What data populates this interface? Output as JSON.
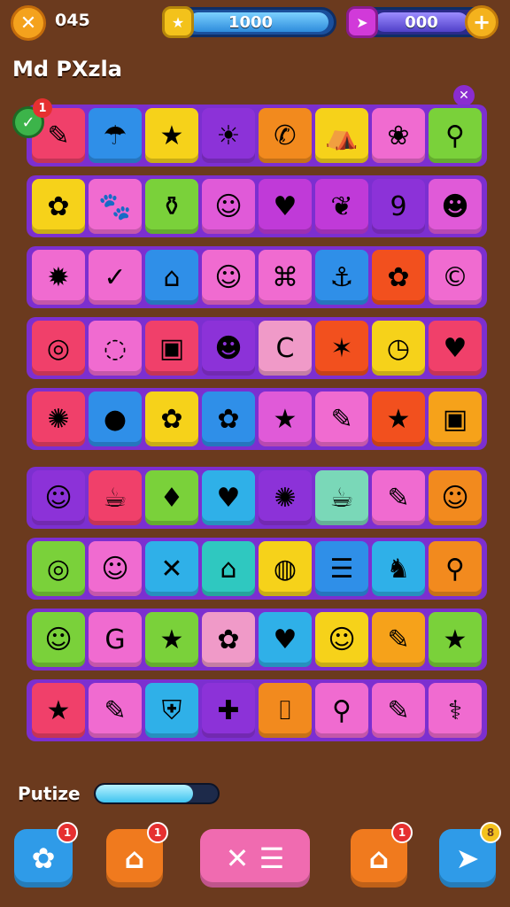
{
  "header": {
    "coin_icon_glyph": "✕",
    "coin_count": "045",
    "left_bar_value": "1000",
    "left_bar_badge_glyph": "★",
    "right_bar_value": "000",
    "right_bar_badge_glyph": "➤",
    "plus_glyph": "+"
  },
  "title": "Md PXzla",
  "progress": {
    "label": "Putize",
    "fraction": 0.8
  },
  "board_a": {
    "rows": [
      [
        [
          "#f0406a",
          "✎"
        ],
        [
          "#2f8fe8",
          "☂"
        ],
        [
          "#f6d21a",
          "★"
        ],
        [
          "#8c32d8",
          "☀"
        ],
        [
          "#f28a1e",
          "✆"
        ],
        [
          "#f6d21a",
          "⛺"
        ],
        [
          "#f06bd0",
          "❀"
        ],
        [
          "#7ad13a",
          "⚲"
        ]
      ],
      [
        [
          "#f6d21a",
          "✿"
        ],
        [
          "#f06bd0",
          "🐾"
        ],
        [
          "#7ad13a",
          "⚱"
        ],
        [
          "#e05ad8",
          "☺"
        ],
        [
          "#c03ad8",
          "♥"
        ],
        [
          "#c03ad8",
          "❦"
        ],
        [
          "#8c32d8",
          "9"
        ],
        [
          "#e05ad8",
          "☻"
        ]
      ],
      [
        [
          "#f06bd0",
          "✹"
        ],
        [
          "#f06bd0",
          "✓"
        ],
        [
          "#2f8fe8",
          "⌂"
        ],
        [
          "#f06bd0",
          "☺"
        ],
        [
          "#f06bd0",
          "⌘"
        ],
        [
          "#2f8fe8",
          "⚓"
        ],
        [
          "#f2501e",
          "✿"
        ],
        [
          "#f06bd0",
          "©"
        ]
      ],
      [
        [
          "#f0406a",
          "◎"
        ],
        [
          "#f06bd0",
          "◌"
        ],
        [
          "#f0406a",
          "▣"
        ],
        [
          "#8c32d8",
          "☻"
        ],
        [
          "#f09ac8",
          "C"
        ],
        [
          "#f2501e",
          "✶"
        ],
        [
          "#f6d21a",
          "◷"
        ],
        [
          "#f0406a",
          "♥"
        ]
      ],
      [
        [
          "#f0406a",
          "✺"
        ],
        [
          "#2f8fe8",
          "●"
        ],
        [
          "#f6d21a",
          "✿"
        ],
        [
          "#2f8fe8",
          "✿"
        ],
        [
          "#e05ad8",
          "★"
        ],
        [
          "#f06bd0",
          "✎"
        ],
        [
          "#f2501e",
          "★"
        ],
        [
          "#f6a21a",
          "▣"
        ]
      ]
    ]
  },
  "board_b": {
    "rows": [
      [
        [
          "#8c32d8",
          "☺"
        ],
        [
          "#f0406a",
          "☕"
        ],
        [
          "#7ad13a",
          "♦"
        ],
        [
          "#2fb0e8",
          "♥"
        ],
        [
          "#8c32d8",
          "✺"
        ],
        [
          "#7ad8b8",
          "☕"
        ],
        [
          "#f06bd0",
          "✎"
        ],
        [
          "#f28a1e",
          "☺"
        ]
      ],
      [
        [
          "#7ad13a",
          "◎"
        ],
        [
          "#f06bd0",
          "☺"
        ],
        [
          "#2fb0e8",
          "✕"
        ],
        [
          "#2fc8c0",
          "⌂"
        ],
        [
          "#f6d21a",
          "◍"
        ],
        [
          "#2f8fe8",
          "☰"
        ],
        [
          "#2fb0e8",
          "♞"
        ],
        [
          "#f28a1e",
          "⚲"
        ]
      ],
      [
        [
          "#7ad13a",
          "☺"
        ],
        [
          "#f06bd0",
          "G"
        ],
        [
          "#7ad13a",
          "★"
        ],
        [
          "#f09ac8",
          "✿"
        ],
        [
          "#2fb0e8",
          "♥"
        ],
        [
          "#f6d21a",
          "☺"
        ],
        [
          "#f6a21a",
          "✎"
        ],
        [
          "#7ad13a",
          "★"
        ]
      ],
      [
        [
          "#f0406a",
          "★"
        ],
        [
          "#f06bd0",
          "✎"
        ],
        [
          "#2fb0e8",
          "⛨"
        ],
        [
          "#8c32d8",
          "✚"
        ],
        [
          "#f28a1e",
          "⌷"
        ],
        [
          "#f06bd0",
          "⚲"
        ],
        [
          "#f06bd0",
          "✎"
        ],
        [
          "#f06bd0",
          "⚕"
        ]
      ]
    ]
  },
  "corner_close_glyph": "✕",
  "check_badge": {
    "glyph": "✓",
    "count": "1"
  },
  "bottom_buttons": [
    {
      "glyph": "✿",
      "badge": "1"
    },
    {
      "glyph": "⌂",
      "badge": "1"
    },
    {
      "glyph": "✕ ☰",
      "badge": ""
    },
    {
      "glyph": "⌂",
      "badge": "1"
    },
    {
      "glyph": "➤",
      "badge": "8"
    }
  ]
}
